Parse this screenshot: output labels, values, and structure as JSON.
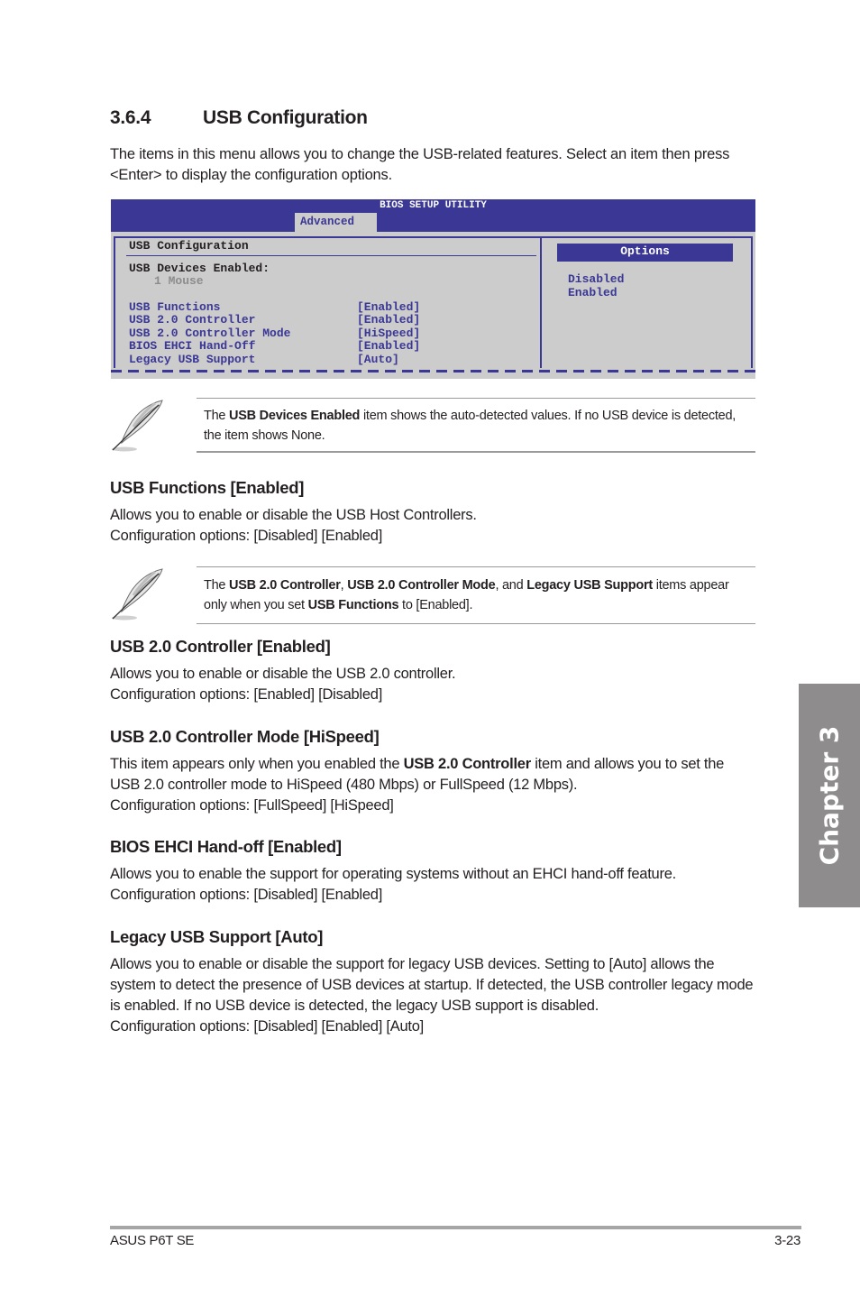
{
  "section": {
    "number": "3.6.4",
    "title": "USB Configuration",
    "intro": "The items in this menu allows you to change the USB-related features. Select an item then press <Enter> to display the configuration options."
  },
  "bios": {
    "title": "BIOS SETUP UTILITY",
    "active_tab": "Advanced",
    "panel_title": "USB Configuration",
    "devices_label": "USB Devices Enabled:",
    "devices_value": "1 Mouse",
    "items": [
      {
        "label": "USB Functions",
        "value": "[Enabled]"
      },
      {
        "label": "USB 2.0 Controller",
        "value": "[Enabled]"
      },
      {
        "label": "USB 2.0 Controller Mode",
        "value": "[HiSpeed]"
      },
      {
        "label": "BIOS EHCI Hand-Off",
        "value": "[Enabled]"
      },
      {
        "label": "Legacy USB Support",
        "value": "[Auto]"
      }
    ],
    "options_header": "Options",
    "options": [
      "Disabled",
      "Enabled"
    ],
    "colors": {
      "bar": "#3a3795",
      "panel": "#cccccc",
      "text_highlight": "#3a3795",
      "muted": "#8c8c8c"
    }
  },
  "notes": [
    {
      "icon": "quill-pen-icon",
      "parts": [
        {
          "text": "The ",
          "bold": false
        },
        {
          "text": "USB Devices Enabled",
          "bold": true
        },
        {
          "text": " item shows the auto-detected values. If no USB device is detected, the item shows None.",
          "bold": false
        }
      ]
    },
    {
      "icon": "quill-pen-icon",
      "parts": [
        {
          "text": "The ",
          "bold": false
        },
        {
          "text": "USB 2.0 Controller",
          "bold": true
        },
        {
          "text": ", ",
          "bold": false
        },
        {
          "text": "USB 2.0 Controller Mode",
          "bold": true
        },
        {
          "text": ", and ",
          "bold": false
        },
        {
          "text": "Legacy USB Support",
          "bold": true
        },
        {
          "text": " items appear only when you set ",
          "bold": false
        },
        {
          "text": "USB Functions",
          "bold": true
        },
        {
          "text": " to [Enabled].",
          "bold": false
        }
      ]
    }
  ],
  "items": [
    {
      "title": "USB Functions [Enabled]",
      "lines": [
        "Allows you to enable or disable the USB Host Controllers.",
        "Configuration options: [Disabled] [Enabled]"
      ]
    },
    {
      "title": "USB 2.0 Controller [Enabled]",
      "lines": [
        "Allows you to enable or disable the USB 2.0 controller.",
        "Configuration options: [Enabled] [Disabled]"
      ]
    },
    {
      "title": "USB 2.0 Controller Mode [HiSpeed]",
      "body_pre": "This item appears only when you enabled the ",
      "body_bold": "USB 2.0 Controller",
      "body_post": " item and allows you to set the USB 2.0 controller mode to HiSpeed (480 Mbps) or FullSpeed (12 Mbps).",
      "options_line": "Configuration options: [FullSpeed] [HiSpeed]"
    },
    {
      "title": "BIOS EHCI Hand-off [Enabled]",
      "lines": [
        "Allows you to enable the support for operating systems without an EHCI hand-off feature.",
        "Configuration options: [Disabled] [Enabled]"
      ]
    },
    {
      "title": "Legacy USB Support [Auto]",
      "body": "Allows you to enable or disable the support for legacy USB devices. Setting to [Auto] allows the system to detect the presence of USB devices at startup. If detected, the USB controller legacy mode is enabled. If no USB device is detected, the legacy USB support is disabled.",
      "options_line": "Configuration options: [Disabled] [Enabled] [Auto]"
    }
  ],
  "chapter_tab": {
    "label": "Chapter 3",
    "color": "#8e8c8d"
  },
  "footer": {
    "product": "ASUS P6T SE",
    "page": "3-23"
  }
}
